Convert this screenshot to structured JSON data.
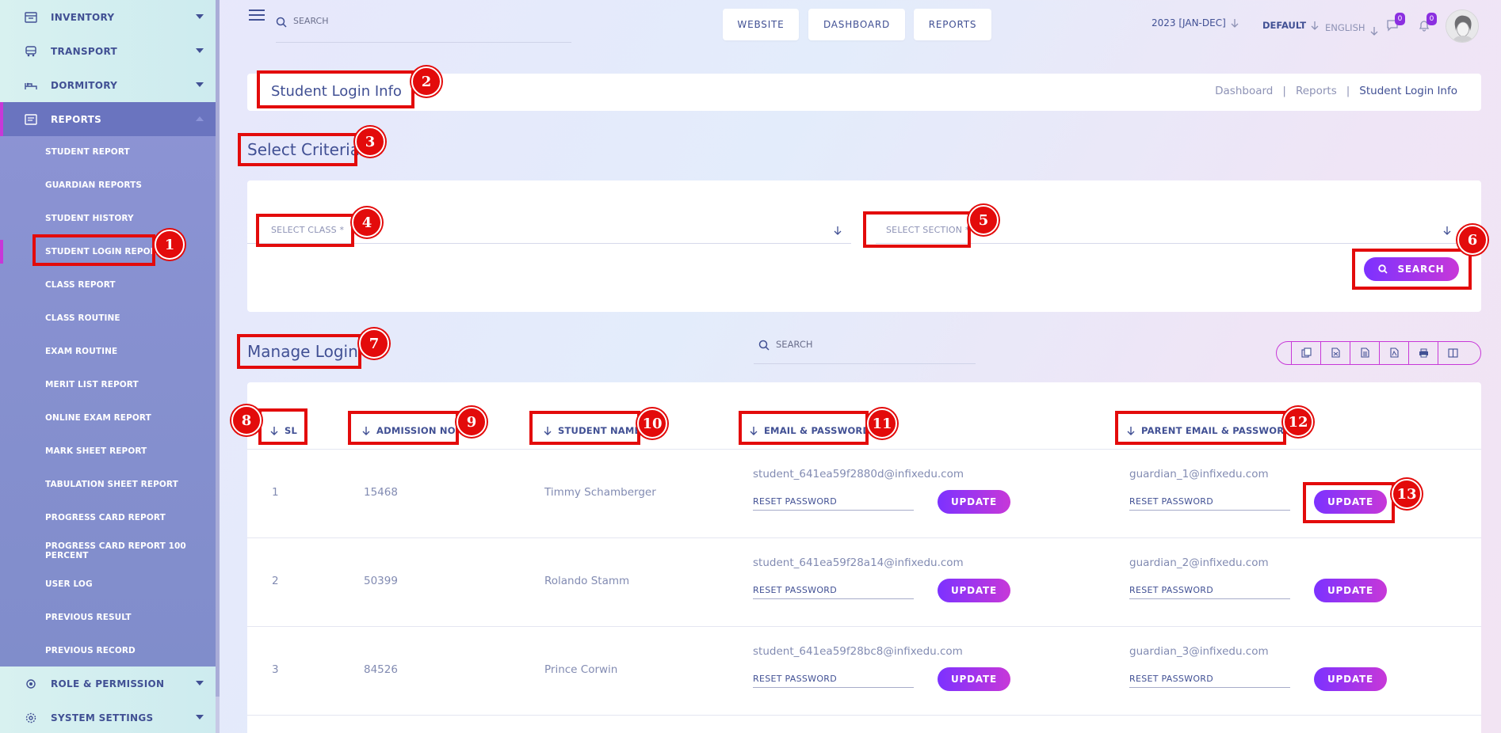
{
  "sidebar": {
    "top_items": [
      {
        "label": "INVENTORY",
        "icon": "inventory-icon"
      },
      {
        "label": "TRANSPORT",
        "icon": "transport-icon"
      },
      {
        "label": "DORMITORY",
        "icon": "dormitory-icon"
      },
      {
        "label": "REPORTS",
        "icon": "reports-icon"
      }
    ],
    "sub_items": [
      "STUDENT REPORT",
      "GUARDIAN REPORTS",
      "STUDENT HISTORY",
      "STUDENT LOGIN REPORT",
      "CLASS REPORT",
      "CLASS ROUTINE",
      "EXAM ROUTINE",
      "MERIT LIST REPORT",
      "ONLINE EXAM REPORT",
      "MARK SHEET REPORT",
      "TABULATION SHEET REPORT",
      "PROGRESS CARD REPORT",
      "PROGRESS CARD REPORT 100 PERCENT",
      "USER LOG",
      "PREVIOUS RESULT",
      "PREVIOUS RECORD"
    ],
    "bottom_items": [
      {
        "label": "ROLE & PERMISSION",
        "icon": "role-permission-icon"
      },
      {
        "label": "SYSTEM SETTINGS",
        "icon": "system-settings-icon"
      }
    ]
  },
  "header": {
    "search_placeholder": "SEARCH",
    "nav": [
      "WEBSITE",
      "DASHBOARD",
      "REPORTS"
    ],
    "academic_year": "2023 [JAN-DEC]",
    "theme": "DEFAULT",
    "language": "ENGLISH",
    "message_count": "0",
    "notification_count": "0"
  },
  "page": {
    "title": "Student Login Info",
    "breadcrumb": [
      "Dashboard",
      "Reports",
      "Student Login Info"
    ]
  },
  "criteria": {
    "title": "Select Criteria",
    "class_placeholder": "SELECT CLASS *",
    "section_placeholder": "SELECT SECTION *",
    "search_button": "SEARCH"
  },
  "table": {
    "title": "Manage Login",
    "search_placeholder": "SEARCH",
    "export_buttons": [
      "copy-icon",
      "excel-icon",
      "csv-icon",
      "pdf-icon",
      "print-icon",
      "columns-icon"
    ],
    "columns": [
      "SL",
      "ADMISSION NO",
      "STUDENT NAME",
      "EMAIL & PASSWORD",
      "PARENT EMAIL & PASSWORD"
    ],
    "reset_placeholder": "RESET PASSWORD",
    "update_label": "UPDATE",
    "rows": [
      {
        "sl": "1",
        "admission": "15468",
        "name": "Timmy Schamberger",
        "email": "student_641ea59f2880d@infixedu.com",
        "parent_email": "guardian_1@infixedu.com"
      },
      {
        "sl": "2",
        "admission": "50399",
        "name": "Rolando Stamm",
        "email": "student_641ea59f28a14@infixedu.com",
        "parent_email": "guardian_2@infixedu.com"
      },
      {
        "sl": "3",
        "admission": "84526",
        "name": "Prince Corwin",
        "email": "student_641ea59f28bc8@infixedu.com",
        "parent_email": "guardian_3@infixedu.com"
      }
    ]
  },
  "annotations": [
    "1",
    "2",
    "3",
    "4",
    "5",
    "6",
    "7",
    "8",
    "9",
    "10",
    "11",
    "12",
    "13"
  ],
  "colors": {
    "accent_start": "#7c32ff",
    "accent_end": "#c738d8",
    "text": "#415094",
    "annotation": "#e30b0b"
  }
}
